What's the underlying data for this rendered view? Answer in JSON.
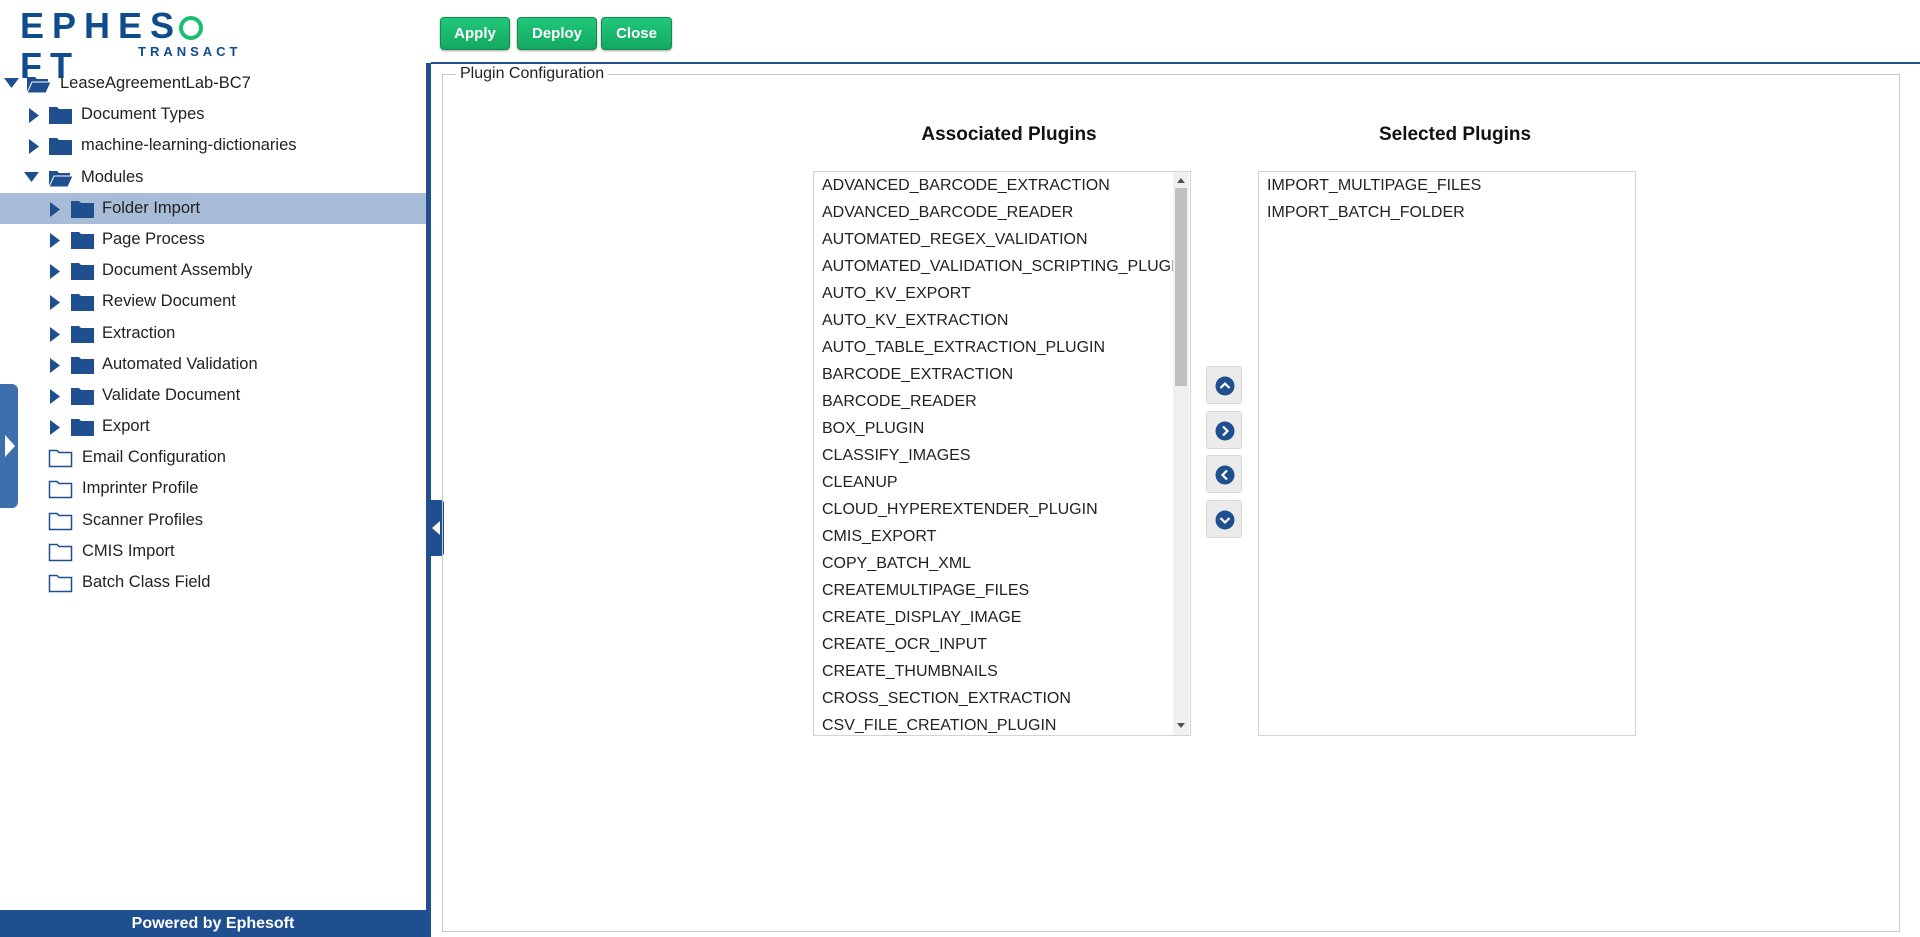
{
  "brand": {
    "logo_word": "EPHES  FT",
    "logo_sub": "TRANSACT",
    "colors": {
      "brand_blue": "#1f4f8f",
      "logo_green": "#1bbf73",
      "button_green": "#1bbd70",
      "selected_row": "#a8bcd7"
    }
  },
  "tree": {
    "root": {
      "label": "LeaseAgreementLab-BC7",
      "icon": "folder-open-icon"
    },
    "items": [
      {
        "label": "Document Types",
        "icon": "folder-icon"
      },
      {
        "label": "machine-learning-dictionaries",
        "icon": "folder-icon"
      },
      {
        "label": "Modules",
        "icon": "folder-open-icon"
      },
      {
        "label": "Folder Import",
        "icon": "folder-icon"
      },
      {
        "label": "Page Process",
        "icon": "folder-icon"
      },
      {
        "label": "Document Assembly",
        "icon": "folder-icon"
      },
      {
        "label": "Review Document",
        "icon": "folder-icon"
      },
      {
        "label": "Extraction",
        "icon": "folder-icon"
      },
      {
        "label": "Automated Validation",
        "icon": "folder-icon"
      },
      {
        "label": "Validate Document",
        "icon": "folder-icon"
      },
      {
        "label": "Export",
        "icon": "folder-icon"
      },
      {
        "label": "Email Configuration",
        "icon": "folder-outline-icon"
      },
      {
        "label": "Imprinter Profile",
        "icon": "folder-outline-icon"
      },
      {
        "label": "Scanner Profiles",
        "icon": "folder-outline-icon"
      },
      {
        "label": "CMIS Import",
        "icon": "folder-outline-icon"
      },
      {
        "label": "Batch Class Field",
        "icon": "folder-outline-icon"
      }
    ]
  },
  "footer": {
    "text": "Powered by Ephesoft"
  },
  "toolbar": {
    "apply_label": "Apply",
    "deploy_label": "Deploy",
    "close_label": "Close"
  },
  "plugin_config": {
    "legend": "Plugin Configuration",
    "associated_title": "Associated Plugins",
    "selected_title": "Selected Plugins",
    "associated": [
      "ADVANCED_BARCODE_EXTRACTION",
      "ADVANCED_BARCODE_READER",
      "AUTOMATED_REGEX_VALIDATION",
      "AUTOMATED_VALIDATION_SCRIPTING_PLUGIN",
      "AUTO_KV_EXPORT",
      "AUTO_KV_EXTRACTION",
      "AUTO_TABLE_EXTRACTION_PLUGIN",
      "BARCODE_EXTRACTION",
      "BARCODE_READER",
      "BOX_PLUGIN",
      "CLASSIFY_IMAGES",
      "CLEANUP",
      "CLOUD_HYPEREXTENDER_PLUGIN",
      "CMIS_EXPORT",
      "COPY_BATCH_XML",
      "CREATEMULTIPAGE_FILES",
      "CREATE_DISPLAY_IMAGE",
      "CREATE_OCR_INPUT",
      "CREATE_THUMBNAILS",
      "CROSS_SECTION_EXTRACTION",
      "CSV_FILE_CREATION_PLUGIN"
    ],
    "selected": [
      "IMPORT_MULTIPAGE_FILES",
      "IMPORT_BATCH_FOLDER"
    ],
    "move_buttons": [
      {
        "name": "move-up-button",
        "icon": "chevron-up-icon"
      },
      {
        "name": "move-right-button",
        "icon": "chevron-right-icon"
      },
      {
        "name": "move-left-button",
        "icon": "chevron-left-icon"
      },
      {
        "name": "move-down-button",
        "icon": "chevron-down-icon"
      }
    ]
  }
}
